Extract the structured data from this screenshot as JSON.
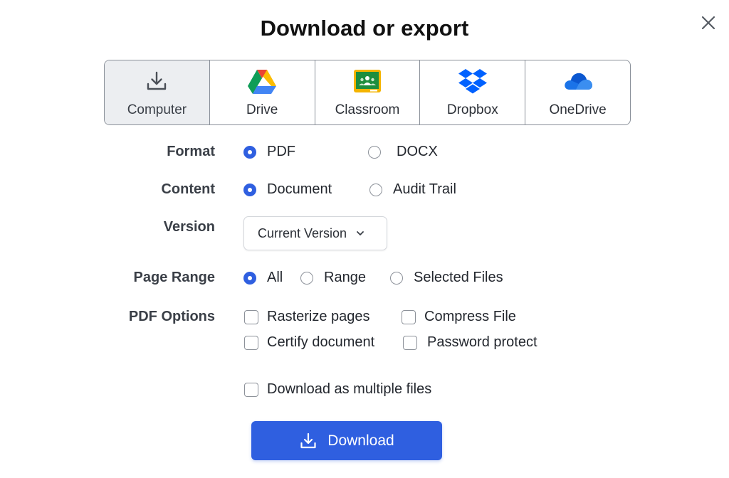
{
  "dialog": {
    "title": "Download or export",
    "close_icon": "close-icon"
  },
  "targets": [
    {
      "label": "Computer",
      "icon": "download-icon",
      "selected": true
    },
    {
      "label": "Drive",
      "icon": "google-drive-icon",
      "selected": false
    },
    {
      "label": "Classroom",
      "icon": "google-classroom-icon",
      "selected": false
    },
    {
      "label": "Dropbox",
      "icon": "dropbox-icon",
      "selected": false
    },
    {
      "label": "OneDrive",
      "icon": "onedrive-icon",
      "selected": false
    }
  ],
  "format": {
    "label": "Format",
    "options": [
      {
        "label": "PDF",
        "selected": true
      },
      {
        "label": "DOCX",
        "selected": false
      }
    ]
  },
  "content": {
    "label": "Content",
    "options": [
      {
        "label": "Document",
        "selected": true
      },
      {
        "label": "Audit Trail",
        "selected": false
      }
    ]
  },
  "version": {
    "label": "Version",
    "value": "Current Version"
  },
  "page_range": {
    "label": "Page Range",
    "options": [
      {
        "label": "All",
        "selected": true
      },
      {
        "label": "Range",
        "selected": false
      },
      {
        "label": "Selected Files",
        "selected": false
      }
    ]
  },
  "pdf_options": {
    "label": "PDF Options",
    "options": [
      {
        "label": "Rasterize pages",
        "checked": false
      },
      {
        "label": "Compress File",
        "checked": false
      },
      {
        "label": "Certify document",
        "checked": false
      },
      {
        "label": "Password protect",
        "checked": false
      }
    ]
  },
  "multiple_files": {
    "label": "Download as multiple files",
    "checked": false
  },
  "download_button": {
    "label": "Download"
  },
  "colors": {
    "accent": "#2f5fe0",
    "selected_tab_bg": "#eceef1",
    "border": "#8a9099"
  }
}
